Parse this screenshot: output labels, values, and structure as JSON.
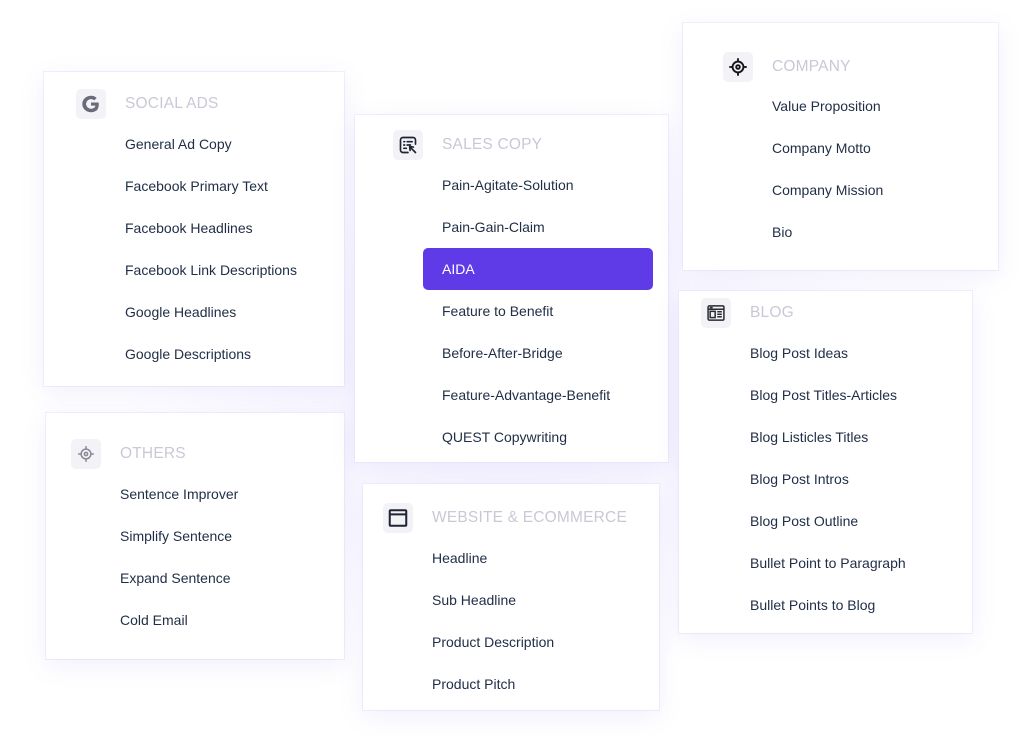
{
  "colors": {
    "accent": "#5f3be8",
    "item_text": "#1f2d45",
    "title_text": "#c9c9d6",
    "icon_bg": "#f2f2f7"
  },
  "cards": {
    "social_ads": {
      "title": "SOCIAL ADS",
      "icon": "google-g-icon",
      "items": [
        "General Ad Copy",
        "Facebook Primary Text",
        "Facebook Headlines",
        "Facebook Link Descriptions",
        "Google Headlines",
        "Google Descriptions"
      ]
    },
    "sales_copy": {
      "title": "SALES COPY",
      "icon": "document-edit-icon",
      "items": [
        "Pain-Agitate-Solution",
        "Pain-Gain-Claim",
        "AIDA",
        "Feature to Benefit",
        "Before-After-Bridge",
        "Feature-Advantage-Benefit",
        "QUEST Copywriting"
      ],
      "selected": "AIDA"
    },
    "company": {
      "title": "COMPANY",
      "icon": "crosshair-target-icon",
      "items": [
        "Value Proposition",
        "Company Motto",
        "Company Mission",
        "Bio"
      ]
    },
    "blog": {
      "title": "BLOG",
      "icon": "blog-layout-icon",
      "items": [
        "Blog Post Ideas",
        "Blog Post Titles-Articles",
        "Blog Listicles Titles",
        "Blog Post Intros",
        "Blog Post Outline",
        "Bullet Point to Paragraph",
        "Bullet Points to Blog"
      ]
    },
    "others": {
      "title": "OTHERS",
      "icon": "crosshair-target-icon",
      "items": [
        "Sentence Improver",
        "Simplify Sentence",
        "Expand Sentence",
        "Cold Email"
      ]
    },
    "website": {
      "title": "WEBSITE & ECOMMERCE",
      "icon": "browser-window-icon",
      "items": [
        "Headline",
        "Sub Headline",
        "Product Description",
        "Product Pitch"
      ]
    }
  }
}
